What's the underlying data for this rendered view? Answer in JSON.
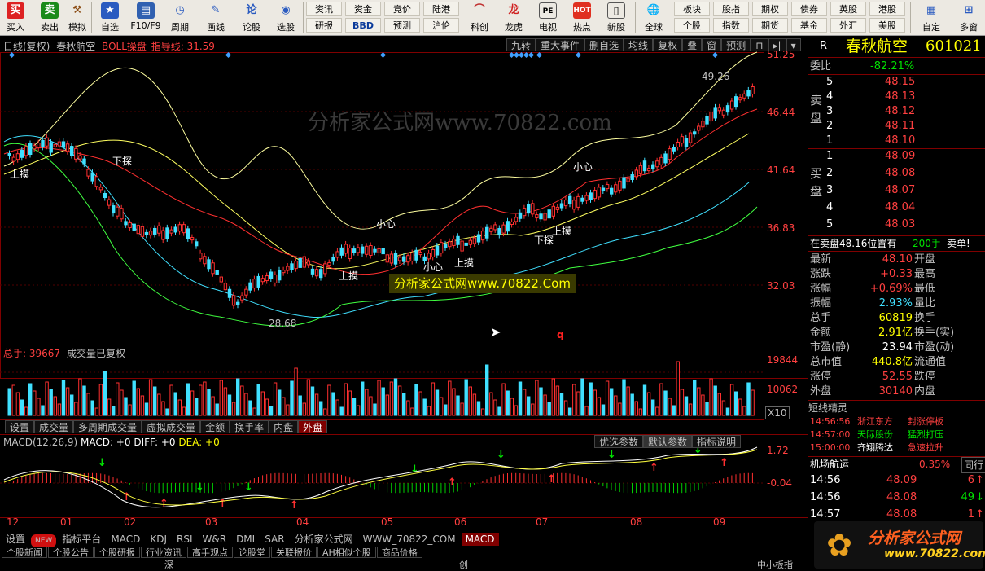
{
  "toolbar": {
    "left_buttons": [
      {
        "label": "买入",
        "icon": "buy-icon"
      },
      {
        "label": "卖出",
        "icon": "sell-icon"
      },
      {
        "label": "模拟",
        "icon": "hammer-icon"
      },
      {
        "label": "自选",
        "icon": "star-icon"
      },
      {
        "label": "F10/F9",
        "icon": "f10-icon"
      },
      {
        "label": "周期",
        "icon": "clock-icon"
      },
      {
        "label": "画线",
        "icon": "pencil-icon"
      },
      {
        "label": "论股",
        "icon": "discuss-icon"
      },
      {
        "label": "选股",
        "icon": "select-icon"
      }
    ],
    "grid_top": [
      "资讯",
      "资金",
      "竞价",
      "陆港"
    ],
    "grid_bottom": [
      "研报",
      "BBD",
      "预测",
      "沪伦"
    ],
    "mid_buttons": [
      {
        "label": "科创",
        "icon": "kechuang-icon"
      },
      {
        "label": "龙虎",
        "icon": "dragon-icon"
      },
      {
        "label": "电视",
        "icon": "tv-icon"
      },
      {
        "label": "热点",
        "icon": "hot-icon"
      },
      {
        "label": "新股",
        "icon": "newstock-icon"
      },
      {
        "label": "全球",
        "icon": "globe-icon"
      }
    ],
    "grid2_top": [
      "板块",
      "股指",
      "期权",
      "债券",
      "英股",
      "港股"
    ],
    "grid2_bottom": [
      "个股",
      "指数",
      "期货",
      "基金",
      "外汇",
      "美股"
    ],
    "right_buttons": [
      {
        "label": "自定",
        "icon": "custom-icon"
      },
      {
        "label": "多窗",
        "icon": "multiwin-icon"
      }
    ]
  },
  "chart": {
    "title": "日线(复权)",
    "stock": "春秋航空",
    "indicator": "BOLL操盘",
    "indicator_value": "指导线: 31.59",
    "top_menu": [
      "九转",
      "重大事件",
      "删自选",
      "均线",
      "复权",
      "叠",
      "窗",
      "预测"
    ],
    "price_axis": [
      "51.25",
      "46.44",
      "41.64",
      "36.83",
      "32.03"
    ],
    "watermark": "分析家公式网www.70822.com",
    "banner": "分析家公式网www.70822.Com",
    "high_label": "49.26",
    "low_label": "28.68",
    "annotations": [
      "上摸",
      "下探",
      "小心",
      "上摸",
      "小心",
      "上摸",
      "上摸",
      "下探",
      "小心",
      "q"
    ]
  },
  "volume": {
    "title": "总手: 39667",
    "subtitle": "成交量已复权",
    "axis": [
      "19844",
      "10062",
      "X10"
    ],
    "tabs": [
      "设置",
      "成交量",
      "多周期成交量",
      "虚拟成交量",
      "金额",
      "换手率",
      "内盘",
      "外盘"
    ]
  },
  "macd": {
    "title": "MACD(12,26,9)",
    "macd": "MACD: +0",
    "diff": "DIFF: +0",
    "dea": "DEA: +0",
    "buttons": [
      "优选参数",
      "默认参数",
      "指标说明"
    ],
    "axis": [
      "1.72",
      "-0.04"
    ],
    "months": [
      "12",
      "01",
      "02",
      "03",
      "04",
      "05",
      "06",
      "07",
      "08",
      "09"
    ]
  },
  "right": {
    "marker": "R",
    "name": "春秋航空",
    "code": "601021",
    "ratio_label": "委比",
    "ratio_value": "-82.21%",
    "sell_label": "卖盘",
    "buy_label": "买盘",
    "asks": [
      {
        "n": "5",
        "p": "48.15"
      },
      {
        "n": "4",
        "p": "48.13"
      },
      {
        "n": "3",
        "p": "48.12"
      },
      {
        "n": "2",
        "p": "48.11"
      },
      {
        "n": "1",
        "p": "48.10"
      }
    ],
    "bids": [
      {
        "n": "1",
        "p": "48.09"
      },
      {
        "n": "2",
        "p": "48.08"
      },
      {
        "n": "3",
        "p": "48.07"
      },
      {
        "n": "4",
        "p": "48.04"
      },
      {
        "n": "5",
        "p": "48.03"
      }
    ],
    "order_notice": "在卖盘48.16位置有",
    "order_qty": "200手",
    "order_action": "卖单!",
    "stats": [
      {
        "l": "最新",
        "v": "48.10",
        "l2": "开盘"
      },
      {
        "l": "涨跌",
        "v": "+0.33",
        "l2": "最高"
      },
      {
        "l": "涨幅",
        "v": "+0.69%",
        "l2": "最低"
      },
      {
        "l": "振幅",
        "v": "2.93%",
        "l2": "量比"
      },
      {
        "l": "总手",
        "v": "60819",
        "l2": "换手"
      },
      {
        "l": "金额",
        "v": "2.91亿",
        "l2": "换手(实)"
      },
      {
        "l": "市盈(静)",
        "v": "23.94",
        "l2": "市盈(动)"
      },
      {
        "l": "总市值",
        "v": "440.8亿",
        "l2": "流通值"
      },
      {
        "l": "涨停",
        "v": "52.55",
        "l2": "跌停"
      },
      {
        "l": "外盘",
        "v": "30140",
        "l2": "内盘"
      }
    ],
    "short_title": "短线精灵",
    "short_items": [
      {
        "t": "14:56:56",
        "n": "浙江东方",
        "e": "封涨停板"
      },
      {
        "t": "14:57:00",
        "n": "天际股份",
        "e": "猛烈打压"
      },
      {
        "t": "15:00:00",
        "n": "齐翔腾达",
        "e": "急速拉升"
      }
    ],
    "sector_name": "机场航运",
    "sector_pct": "0.35%",
    "sector_tag": "同行",
    "ticks": [
      {
        "t": "14:56",
        "p": "48.09",
        "q": "6",
        "d": "up"
      },
      {
        "t": "14:56",
        "p": "48.08",
        "q": "49",
        "d": "down"
      },
      {
        "t": "14:57",
        "p": "48.08",
        "q": "1",
        "d": "up"
      }
    ]
  },
  "bottom": {
    "tabs": [
      "设置",
      "NEW",
      "指标平台",
      "MACD",
      "KDJ",
      "RSI",
      "W&R",
      "DMI",
      "SAR",
      "分析家公式网",
      "WWW_70822_COM",
      "MACD"
    ],
    "news": [
      "个股新闻",
      "个股公告",
      "个股研报",
      "行业资讯",
      "高手观点",
      "论股堂",
      "关联报价",
      "AH相似个股",
      "商品价格"
    ],
    "logo_text": "分析家公式网",
    "logo_url": "www.70822.com",
    "status_a": "深",
    "status_b": "创",
    "status_c": "中小板指"
  }
}
